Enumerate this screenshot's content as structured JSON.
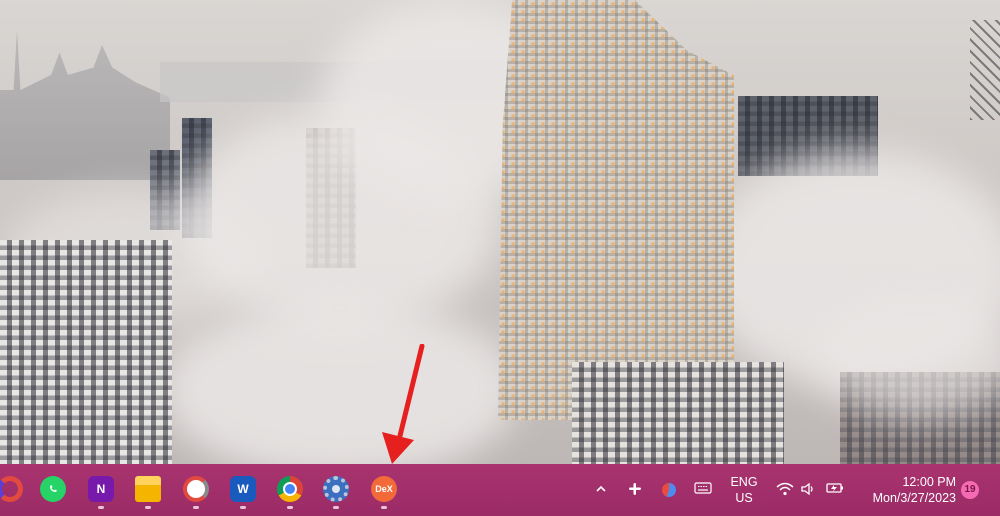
{
  "taskbar": {
    "apps": [
      {
        "name": "edge-partial",
        "label": ""
      },
      {
        "name": "whatsapp",
        "label": ""
      },
      {
        "name": "onenote",
        "label": "N"
      },
      {
        "name": "file-explorer",
        "label": ""
      },
      {
        "name": "photo-app",
        "label": ""
      },
      {
        "name": "word",
        "label": "W"
      },
      {
        "name": "chrome",
        "label": ""
      },
      {
        "name": "settings",
        "label": ""
      },
      {
        "name": "samsung-dex",
        "label": "DeX"
      }
    ],
    "tray": {
      "language_line1": "ENG",
      "language_line2": "US",
      "time": "12:00 PM",
      "date": "Mon/3/27/2023",
      "notification_count": "19"
    }
  },
  "colors": {
    "taskbar": "#a9336f",
    "annotation_arrow": "#e5201f",
    "dex_icon": "#f26a3a"
  }
}
